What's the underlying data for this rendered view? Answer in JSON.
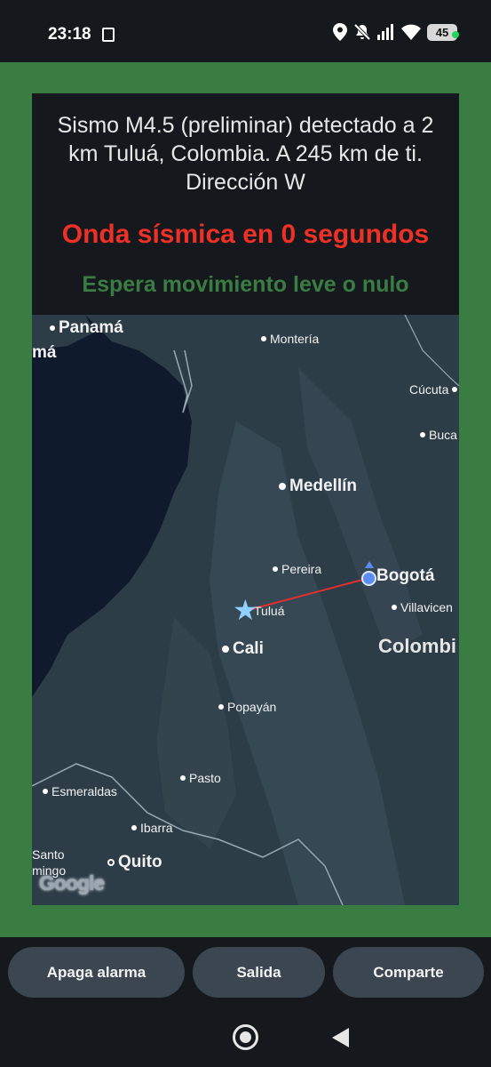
{
  "status_bar": {
    "time": "23:18",
    "battery": "45"
  },
  "alert": {
    "message": "Sismo M4.5 (preliminar) detectado a 2 km Tuluá, Colombia. A 245 km de ti. Dirección W",
    "countdown": "Onda sísmica en 0 segundos",
    "expectation": "Espera movimiento leve o nulo",
    "colors": {
      "countdown": "#ee3026",
      "expectation": "#3a7d42",
      "frame": "#3a7d42"
    }
  },
  "map": {
    "cities": {
      "panama": "Panamá",
      "panama_cut": "má",
      "monteria": "Montería",
      "cucuta": "Cúcuta",
      "bucaramanga": "Buca",
      "medellin": "Medellín",
      "pereira": "Pereira",
      "bogota": "Bogotá",
      "villavicencio": "Villavicen",
      "tulua": "Tuluá",
      "cali": "Cali",
      "popayan": "Popayán",
      "pasto": "Pasto",
      "esmeraldas": "Esmeraldas",
      "ibarra": "Ibarra",
      "santo": "Santo",
      "domingo": "mingo",
      "quito": "Quito"
    },
    "country_label": "Colombi",
    "attribution": "Google",
    "epicenter_icon": "star-icon",
    "user_icon": "user-location-icon"
  },
  "actions": {
    "stop_alarm": "Apaga alarma",
    "exit": "Salida",
    "share": "Comparte"
  }
}
